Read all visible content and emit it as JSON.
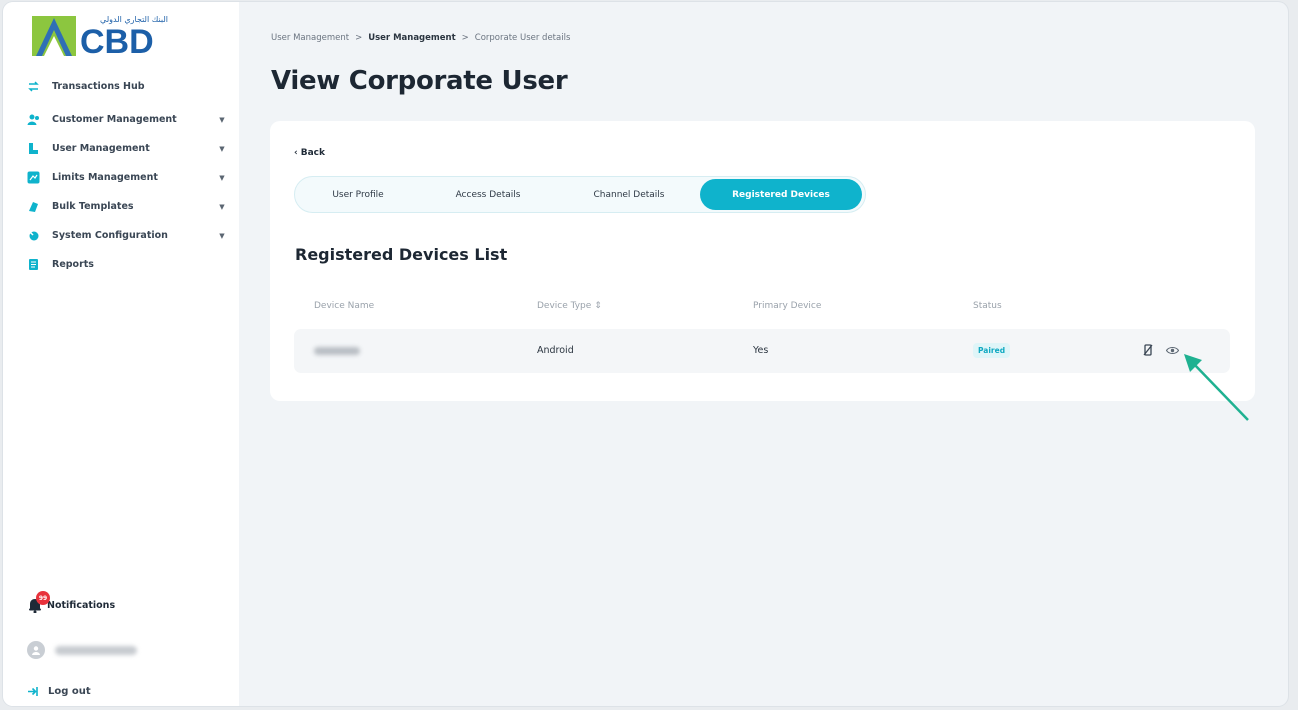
{
  "brand": {
    "name": "CBD",
    "tagline_ar": "البنك التجاري الدولي",
    "colors": {
      "accent": "#0fb3cc",
      "logo_blue": "#1c5fa8",
      "logo_green": "#8cc63f",
      "badge_red": "#e8323c",
      "arrow": "#1fb191"
    }
  },
  "sidebar": {
    "items": [
      {
        "label": "Transactions Hub",
        "icon": "transactions-icon",
        "expandable": false
      },
      {
        "label": "Customer Management",
        "icon": "customer-icon",
        "expandable": true
      },
      {
        "label": "User Management",
        "icon": "user-icon",
        "expandable": true
      },
      {
        "label": "Limits Management",
        "icon": "limits-icon",
        "expandable": true
      },
      {
        "label": "Bulk Templates",
        "icon": "template-icon",
        "expandable": true
      },
      {
        "label": "System Configuration",
        "icon": "config-icon",
        "expandable": true
      },
      {
        "label": "Reports",
        "icon": "reports-icon",
        "expandable": false
      }
    ],
    "notifications": {
      "label": "Notifications",
      "icon": "bell-icon"
    },
    "logout": {
      "label": "Log out",
      "icon": "logout-icon"
    }
  },
  "breadcrumb": [
    "User Management",
    "User Management",
    "Corporate User details"
  ],
  "breadcrumb_sep": ">",
  "page": {
    "title": "View Corporate User",
    "back_label": "Back",
    "tabs": [
      {
        "label": "User Profile",
        "active": false
      },
      {
        "label": "Access Details",
        "active": false
      },
      {
        "label": "Channel Details",
        "active": false
      },
      {
        "label": "Registered Devices",
        "active": true
      }
    ],
    "section_title": "Registered Devices List",
    "table": {
      "headers": [
        "Device Name",
        "Device Type",
        "Primary Device",
        "Status"
      ],
      "sort_icon": "⇕",
      "rows": [
        {
          "device_type": "Android",
          "primary": "Yes",
          "status": "Paired"
        }
      ]
    }
  }
}
